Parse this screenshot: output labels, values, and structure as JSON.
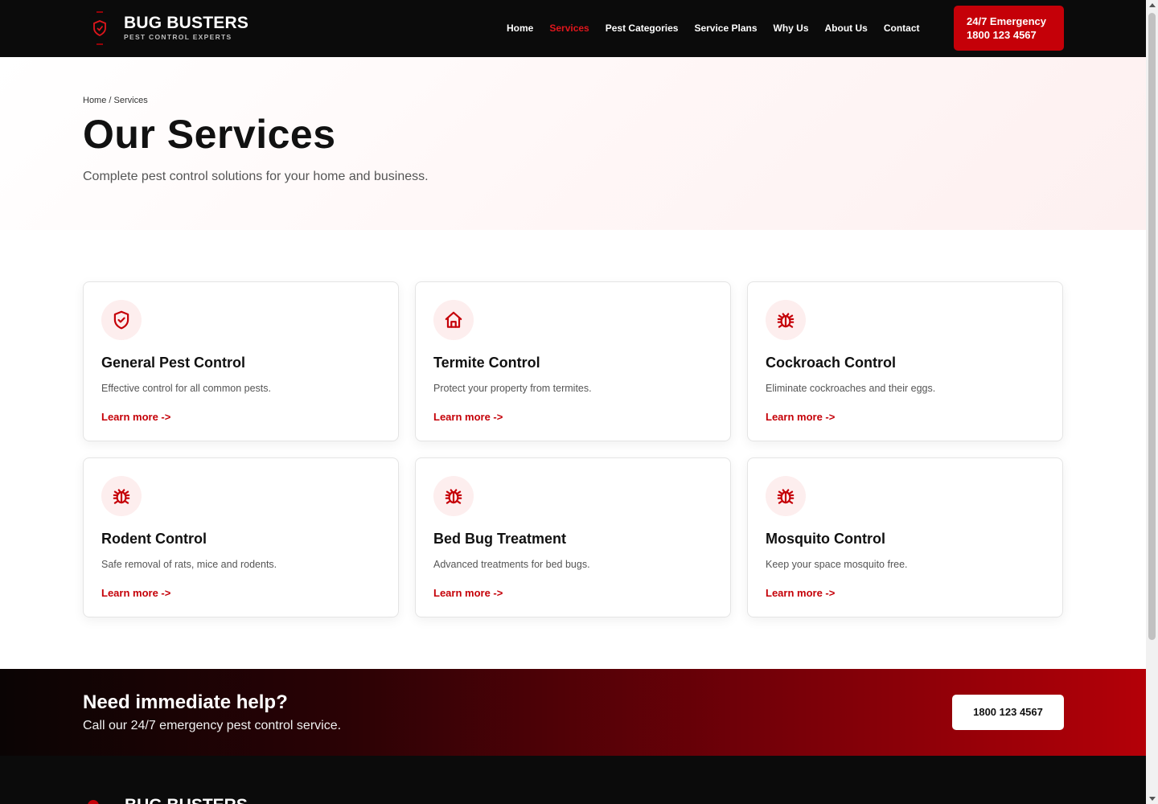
{
  "brand": {
    "name": "BUG BUSTERS",
    "tagline": "PEST CONTROL EXPERTS",
    "accent_color": "#c50008",
    "icon": "shield-logo-icon"
  },
  "nav": {
    "items": [
      {
        "label": "Home",
        "active": false
      },
      {
        "label": "Services",
        "active": true
      },
      {
        "label": "Pest Categories",
        "active": false
      },
      {
        "label": "Service Plans",
        "active": false
      },
      {
        "label": "Why Us",
        "active": false
      },
      {
        "label": "About Us",
        "active": false
      },
      {
        "label": "Contact",
        "active": false
      }
    ],
    "emergency": {
      "line1": "24/7 Emergency",
      "line2": "1800 123 4567"
    }
  },
  "hero": {
    "breadcrumb": "Home / Services",
    "title": "Our Services",
    "subtitle": "Complete pest control solutions for your home and business."
  },
  "services": [
    {
      "title": "General Pest Control",
      "description": "Effective control for all common pests.",
      "link": "Learn more ->",
      "icon": "shield-check-icon"
    },
    {
      "title": "Termite Control",
      "description": "Protect your property from termites.",
      "link": "Learn more ->",
      "icon": "home-icon"
    },
    {
      "title": "Cockroach Control",
      "description": "Eliminate cockroaches and their eggs.",
      "link": "Learn more ->",
      "icon": "bug-icon"
    },
    {
      "title": "Rodent Control",
      "description": "Safe removal of rats, mice and rodents.",
      "link": "Learn more ->",
      "icon": "bug-icon"
    },
    {
      "title": "Bed Bug Treatment",
      "description": "Advanced treatments for bed bugs.",
      "link": "Learn more ->",
      "icon": "bug-icon"
    },
    {
      "title": "Mosquito Control",
      "description": "Keep your space mosquito free.",
      "link": "Learn more ->",
      "icon": "bug-icon"
    }
  ],
  "cta": {
    "title": "Need immediate help?",
    "subtitle": "Call our 24/7 emergency pest control service.",
    "button": "1800 123 4567"
  },
  "footer": {
    "brand": "BUG BUSTERS"
  }
}
